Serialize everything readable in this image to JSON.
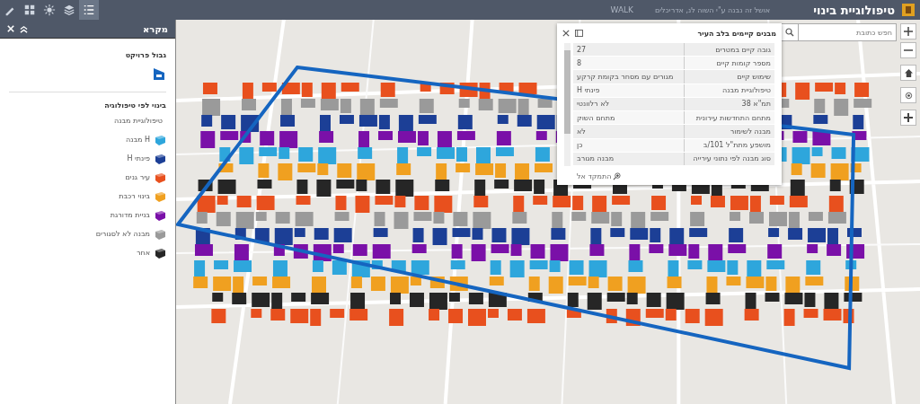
{
  "header": {
    "title": "טיפולוגיית בינוי",
    "description": "אושל זה נבנה ע\"י השוה לנ, אדריכלים",
    "subtitle": "WALK",
    "tools": [
      {
        "kind": "pencil",
        "selected": false
      },
      {
        "kind": "grid",
        "selected": false
      },
      {
        "kind": "sun",
        "selected": false
      },
      {
        "kind": "layers",
        "selected": false
      },
      {
        "kind": "legend",
        "selected": true
      }
    ]
  },
  "legend": {
    "title": "מקרא",
    "boundary_title": "גבול פרויקט",
    "section_title": "בינוי לפי טיפולוגיה",
    "group_title": "טיפולוגיית מבנה",
    "items": [
      {
        "label": "H מבנה",
        "color": "#2ea6dc"
      },
      {
        "label": "פינתי H",
        "color": "#1c3f96"
      },
      {
        "label": "עיר גנים",
        "color": "#e8501e"
      },
      {
        "label": "בינוי רכבת",
        "color": "#f0a020"
      },
      {
        "label": "בניית מדורגת",
        "color": "#7a10a8"
      },
      {
        "label": "מבנה לא לסגורים",
        "color": "#9a9a9a"
      },
      {
        "label": "אחר",
        "color": "#262626"
      }
    ]
  },
  "search": {
    "placeholder": "חפש כתובת"
  },
  "popup": {
    "title": "מבנים קיימים בלב העיר",
    "zoom_label": "התמקד אל",
    "rows": [
      {
        "field": "גובה קיים במטרים",
        "value": "27"
      },
      {
        "field": "מספר קומות קיים",
        "value": "8"
      },
      {
        "field": "שימוש קיים",
        "value": "מגורים עם מסחר בקומת קרקע"
      },
      {
        "field": "טיפולוגיית מבנה",
        "value": "פינתי H"
      },
      {
        "field": "תמ\"א 38",
        "value": "לא רלוונטי"
      },
      {
        "field": "מתחם התחדשות עירונית",
        "value": "מתחם השוק"
      },
      {
        "field": "מבנה לשימור",
        "value": "לא"
      },
      {
        "field": "מושפע מתת\"ל 101/ב",
        "value": "כן"
      },
      {
        "field": "סוג מבנה לפי נתוני עירייה",
        "value": "מבנה מגורב"
      }
    ]
  }
}
